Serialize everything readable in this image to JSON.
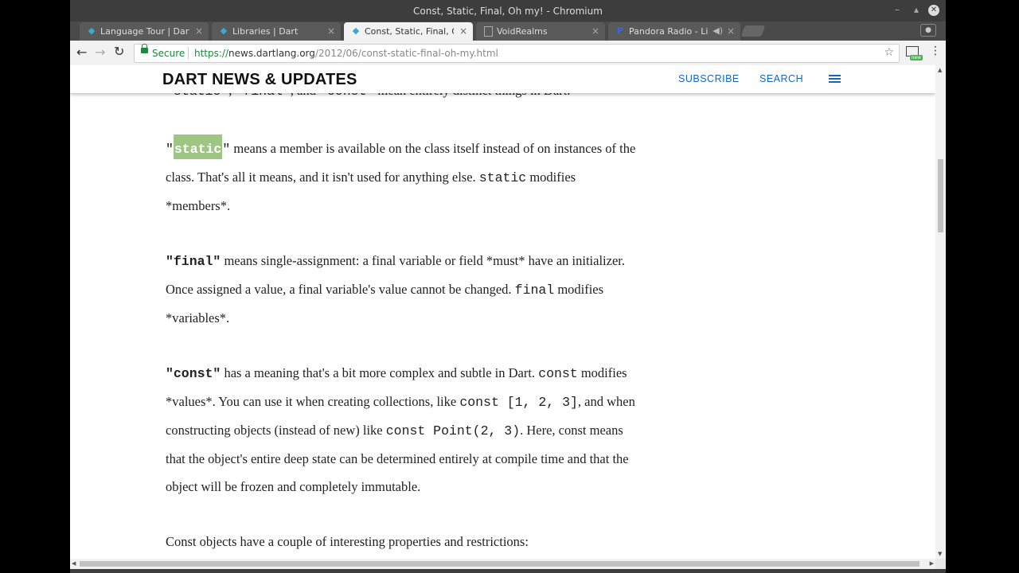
{
  "window": {
    "title": "Const, Static, Final, Oh my! - Chromium",
    "minimize_glyph": "–",
    "maximize_glyph": "▴",
    "close_glyph": "✕"
  },
  "tabs": [
    {
      "label": "Language Tour | Dart",
      "icon": "dart-logo-icon",
      "active": false
    },
    {
      "label": "Libraries | Dart",
      "icon": "dart-logo-icon",
      "active": false
    },
    {
      "label": "Const, Static, Final, Oh my!",
      "icon": "dart-logo-icon",
      "active": true
    },
    {
      "label": "VoidRealms",
      "icon": "page-icon",
      "active": false
    },
    {
      "label": "Pandora Radio - Listen to Free Internet Radio",
      "icon": "pandora-icon",
      "active": false
    }
  ],
  "tab_close_glyph": "×",
  "tab_mute_glyph": "◀)",
  "toolbar": {
    "back_glyph": "←",
    "forward_glyph": "→",
    "reload_glyph": "↻",
    "secure_label": "Secure",
    "url_scheme": "https://",
    "url_host": "news.dartlang.org",
    "url_path": "/2012/06/const-static-final-oh-my.html",
    "star_glyph": "☆",
    "ext_badge": "new",
    "menu_glyph": "⋮"
  },
  "site": {
    "title": "DART NEWS & UPDATES",
    "subscribe": "SUBSCRIBE",
    "search": "SEARCH"
  },
  "article": {
    "cut_line": {
      "p1": "\"static\"",
      "p2": ", ",
      "p3": "\"final\"",
      "p4": ", and ",
      "p5": "\"const\"",
      "p6": " mean entirely distinct things in Dart."
    },
    "static": {
      "q1": "\"",
      "kw": "static",
      "q2": "\"",
      "l1": " means a member is available on the class itself instead of on instances of the",
      "l2a": "class. That's all it means, and it isn't used for anything else. ",
      "l2code": "static",
      "l2b": " modifies",
      "l3": "*members*."
    },
    "final": {
      "kw": "\"final\"",
      "l1": " means single-assignment: a final variable or field *must* have an initializer.",
      "l2a": "Once assigned a value, a final variable's value cannot be changed. ",
      "l2code": "final",
      "l2b": " modifies",
      "l3": "*variables*."
    },
    "const": {
      "kw": "\"const\"",
      "l1a": " has a meaning that's a bit more complex and subtle in Dart. ",
      "l1code": "const",
      "l1b": " modifies",
      "l2a": "*values*. You can use it when creating collections, like ",
      "l2code": "const [1, 2, 3]",
      "l2b": ", and when",
      "l3a": "constructing objects (instead of new) like ",
      "l3code": "const Point(2, 3)",
      "l3b": ". Here, const means",
      "l4": "that the object's entire deep state can be determined entirely at compile time and that the",
      "l5": "object will be frozen and completely immutable."
    },
    "last": "Const objects have a couple of interesting properties and restrictions:"
  },
  "colors": {
    "highlight": "#9fc584",
    "link": "#1565c0",
    "secure": "#1a8a3a"
  }
}
